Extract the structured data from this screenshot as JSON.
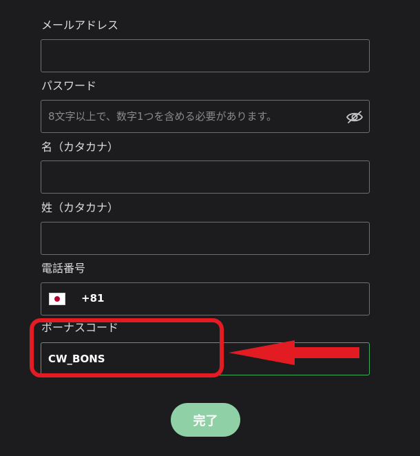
{
  "form": {
    "email": {
      "label": "メールアドレス",
      "value": "",
      "placeholder": ""
    },
    "password": {
      "label": "パスワード",
      "value": "",
      "placeholder": "8文字以上で、数字1つを含める必要があります。",
      "toggle_icon": "eye-off-icon"
    },
    "first_name_kana": {
      "label": "名（カタカナ）",
      "value": "",
      "placeholder": ""
    },
    "last_name_kana": {
      "label": "姓（カタカナ）",
      "value": "",
      "placeholder": ""
    },
    "phone": {
      "label": "電話番号",
      "country_flag": "japan-flag-icon",
      "country_code": "+81",
      "value": "",
      "placeholder": ""
    },
    "bonus_code": {
      "label": "ボーナスコード",
      "value": "CW_BONS",
      "placeholder": ""
    }
  },
  "submit_label": "完了",
  "colors": {
    "background": "#1c1c1f",
    "field_border": "#6f6f73",
    "bonus_border": "#3fae5a",
    "submit_bg": "#8fd0a6",
    "annotation_red": "#e31b23"
  }
}
